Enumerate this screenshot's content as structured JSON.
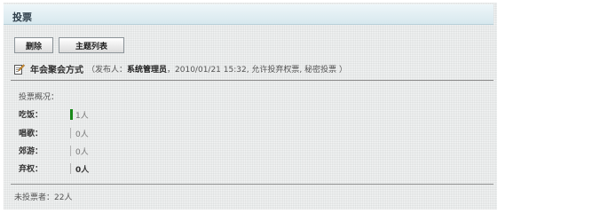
{
  "header": {
    "title": "投票"
  },
  "toolbar": {
    "delete_label": "删除",
    "topic_list_label": "主题列表"
  },
  "topic": {
    "icon": "edit-icon",
    "title": "年会聚会方式",
    "meta_open": "（发布人：",
    "publisher": "系统管理员",
    "meta_rest": "，2010/01/21 15:32, 允许投弃权票, 秘密投票 ）"
  },
  "votes": {
    "heading": "投票概况：",
    "options": [
      {
        "label": "吃饭：",
        "count": "1人",
        "has_votes": true
      },
      {
        "label": "唱歌：",
        "count": "0人",
        "has_votes": false
      },
      {
        "label": "郊游：",
        "count": "0人",
        "has_votes": false
      },
      {
        "label": "弃权：",
        "count": "0人",
        "has_votes": false
      }
    ]
  },
  "footer": {
    "not_voted": "未投票者：22人"
  },
  "colors": {
    "bar_voted": "#1a8a1a",
    "bar_empty": "#b5b5b5",
    "header_bg": "#d7e8ee"
  }
}
